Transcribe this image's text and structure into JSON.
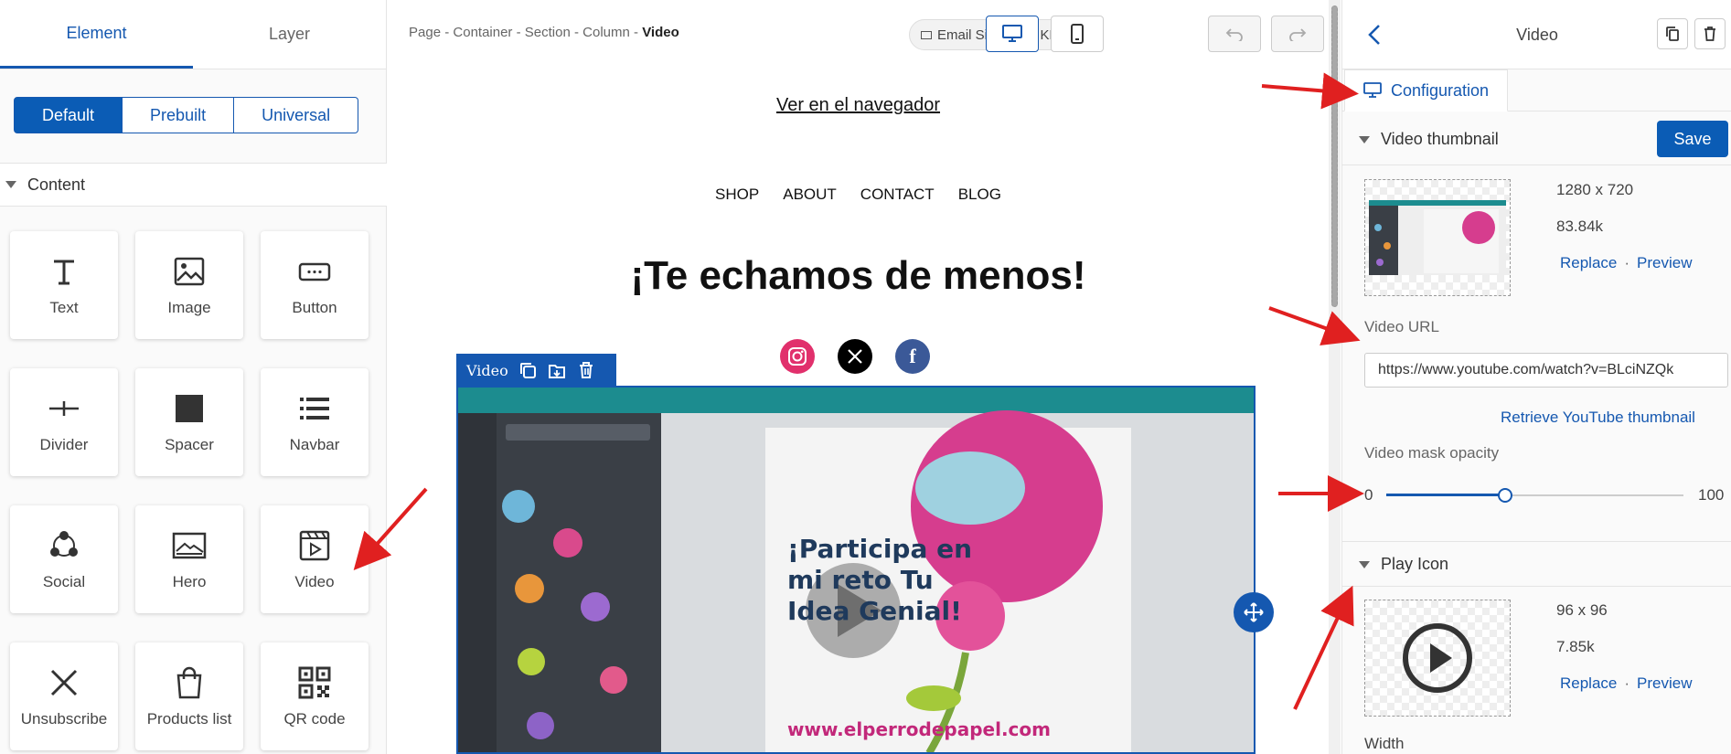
{
  "left_panel": {
    "tabs": [
      "Element",
      "Layer"
    ],
    "segments": [
      "Default",
      "Prebuilt",
      "Universal"
    ],
    "section_label": "Content",
    "elements": [
      {
        "label": "Text",
        "icon": "text-icon"
      },
      {
        "label": "Image",
        "icon": "image-icon"
      },
      {
        "label": "Button",
        "icon": "button-icon"
      },
      {
        "label": "Divider",
        "icon": "divider-icon"
      },
      {
        "label": "Spacer",
        "icon": "spacer-icon"
      },
      {
        "label": "Navbar",
        "icon": "navbar-icon"
      },
      {
        "label": "Social",
        "icon": "social-icon"
      },
      {
        "label": "Hero",
        "icon": "hero-icon"
      },
      {
        "label": "Video",
        "icon": "video-icon"
      },
      {
        "label": "Unsubscribe",
        "icon": "close-icon"
      },
      {
        "label": "Products list",
        "icon": "shopping-bag-icon"
      },
      {
        "label": "QR code",
        "icon": "qr-code-icon"
      }
    ]
  },
  "toolbar": {
    "breadcrumb": [
      "Page",
      "Container",
      "Section",
      "Column"
    ],
    "breadcrumb_current": "Video",
    "breadcrumb_sep": "-",
    "email_size": "Email Size: 33.7 KB"
  },
  "canvas": {
    "browser_link": "Ver en el navegador",
    "nav": [
      "SHOP",
      "ABOUT",
      "CONTACT",
      "BLOG"
    ],
    "headline": "¡Te echamos de menos!",
    "video_label": "Video",
    "video_overlay_text": "¡Participa en mi reto Tu Idea Genial!",
    "video_overlay_url": "www.elperrodepapel.com",
    "colors": {
      "accent": "#1558b0",
      "instagram": "#e1306c",
      "x": "#000000",
      "facebook": "#3b5998"
    }
  },
  "right_panel": {
    "title": "Video",
    "config_tab": "Configuration",
    "save_label": "Save",
    "thumbnail": {
      "heading": "Video thumbnail",
      "dimensions": "1280 x 720",
      "size": "83.84k",
      "replace": "Replace",
      "preview": "Preview",
      "sep": "·"
    },
    "video_url_label": "Video URL",
    "video_url_value": "https://www.youtube.com/watch?v=BLciNZQk",
    "retrieve_label": "Retrieve YouTube thumbnail",
    "mask_label": "Video mask opacity",
    "mask_min": "0",
    "mask_max": "100",
    "mask_value": 40,
    "play_icon": {
      "heading": "Play Icon",
      "dimensions": "96 x 96",
      "size": "7.85k",
      "replace": "Replace",
      "preview": "Preview",
      "sep": "·"
    },
    "width_label": "Width"
  }
}
